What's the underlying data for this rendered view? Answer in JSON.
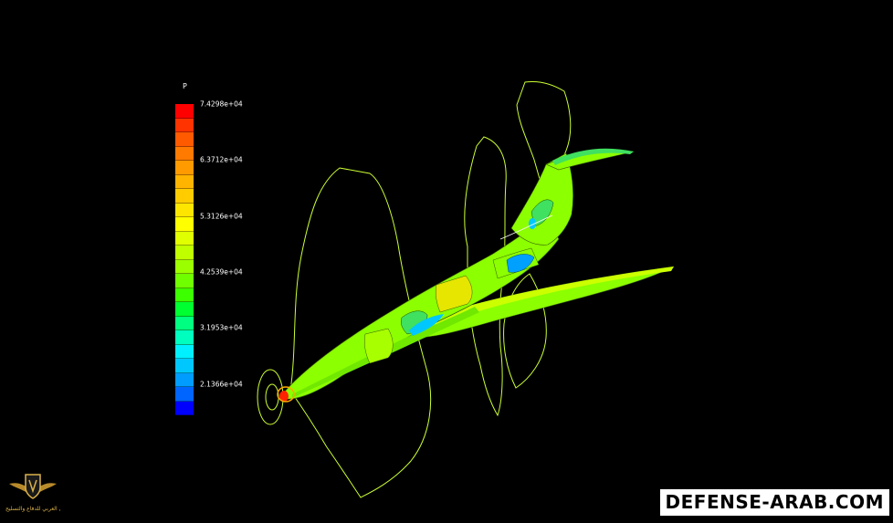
{
  "legend": {
    "variable": "P",
    "ticks": [
      "7.4298e+04",
      "6.3712e+04",
      "5.3126e+04",
      "4.2539e+04",
      "3.1953e+04",
      "2.1366e+04"
    ],
    "colors": [
      "#ff0000",
      "#ff3300",
      "#ff5a00",
      "#ff7a00",
      "#ff9a00",
      "#ffb400",
      "#ffcc00",
      "#ffe600",
      "#ffff00",
      "#e0ff00",
      "#c0ff00",
      "#9cff00",
      "#70ff00",
      "#3cff00",
      "#00ff30",
      "#00ff80",
      "#00ffbe",
      "#00f0ff",
      "#00c8ff",
      "#009cff",
      "#0064ff",
      "#0000ff"
    ]
  },
  "watermark": {
    "text": "DEFENSE-ARAB.COM"
  },
  "logo": {
    "text": "المنتدى العربي للدفاع والتسليح"
  },
  "colors": {
    "background": "#000000",
    "contour_line": "#ccff33",
    "surface_main": "#8cff00",
    "surface_light": "#ccff00",
    "surface_yellow": "#e6e600",
    "low_pressure": "#00c8ff",
    "high_pressure": "#ff2200"
  }
}
